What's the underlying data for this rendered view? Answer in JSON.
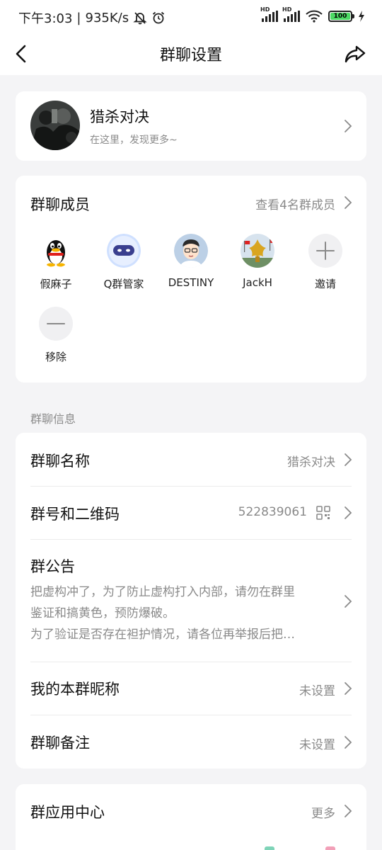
{
  "status_bar": {
    "time": "下午3:03",
    "separator": "|",
    "speed": "935K/s",
    "battery": "100"
  },
  "nav": {
    "title": "群聊设置",
    "back_icon": "chevron-left-icon",
    "share_icon": "share-icon"
  },
  "group": {
    "name": "猎杀对决",
    "subtitle": "在这里，发现更多~"
  },
  "members": {
    "title": "群聊成员",
    "view_all": "查看4名群成员",
    "list": [
      {
        "name": "假麻子",
        "icon": "qq-penguin-avatar"
      },
      {
        "name": "Q群管家",
        "icon": "robot-avatar"
      },
      {
        "name": "DESTINY",
        "icon": "cartoon-boy-avatar"
      },
      {
        "name": "JackH",
        "icon": "golden-statue-avatar"
      }
    ],
    "invite_label": "邀请",
    "remove_label": "移除"
  },
  "info_section_label": "群聊信息",
  "info": {
    "group_name_label": "群聊名称",
    "group_name_value": "猎杀对决",
    "group_id_label": "群号和二维码",
    "group_id_value": "522839061",
    "notice_label": "群公告",
    "notice_lines": [
      "把虚构冲了，为了防止虚构打入内部，请勿在群里",
      "鉴证和搞黄色，预防爆破。",
      "为了验证是否存在袒护情况，请各位再举报后把…"
    ],
    "nickname_label": "我的本群昵称",
    "nickname_value": "未设置",
    "remark_label": "群聊备注",
    "remark_value": "未设置"
  },
  "apps": {
    "title": "群应用中心",
    "more": "更多"
  },
  "colors": {
    "background": "#f4f4f6",
    "card": "#ffffff",
    "primary_text": "#111111",
    "secondary_text": "#8a8a8a",
    "battery_green": "#4cd964"
  }
}
